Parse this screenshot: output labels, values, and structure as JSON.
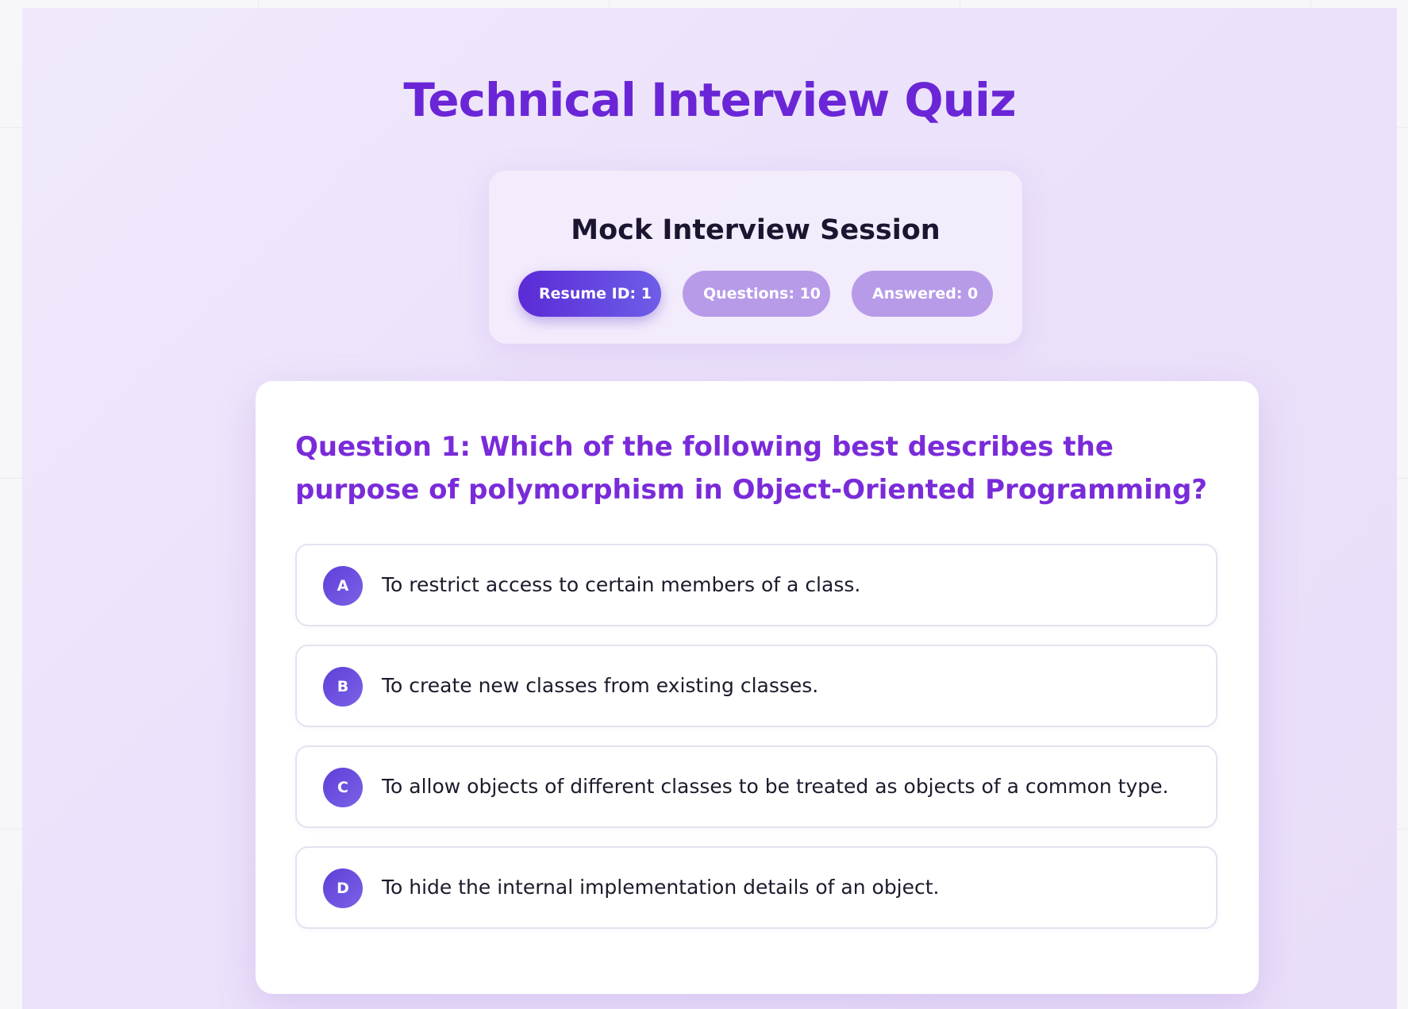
{
  "page": {
    "title": "Technical Interview Quiz"
  },
  "session": {
    "title": "Mock Interview Session",
    "badges": {
      "resume_id": "Resume ID: 1",
      "questions": "Questions: 10",
      "answered": "Answered: 0"
    }
  },
  "quiz": {
    "question": "Question 1: Which of the following best describes the purpose of polymorphism in Object-Oriented Programming?",
    "options": [
      {
        "letter": "A",
        "text": "To restrict access to certain members of a class."
      },
      {
        "letter": "B",
        "text": "To create new classes from existing classes."
      },
      {
        "letter": "C",
        "text": "To allow objects of different classes to be treated as objects of a common type."
      },
      {
        "letter": "D",
        "text": "To hide the internal implementation details of an object."
      }
    ]
  },
  "colors": {
    "accent": "#6a26d6",
    "question_text": "#7a2bd9",
    "badge_active": "#5b2ad6",
    "badge_muted": "#b79be8"
  }
}
